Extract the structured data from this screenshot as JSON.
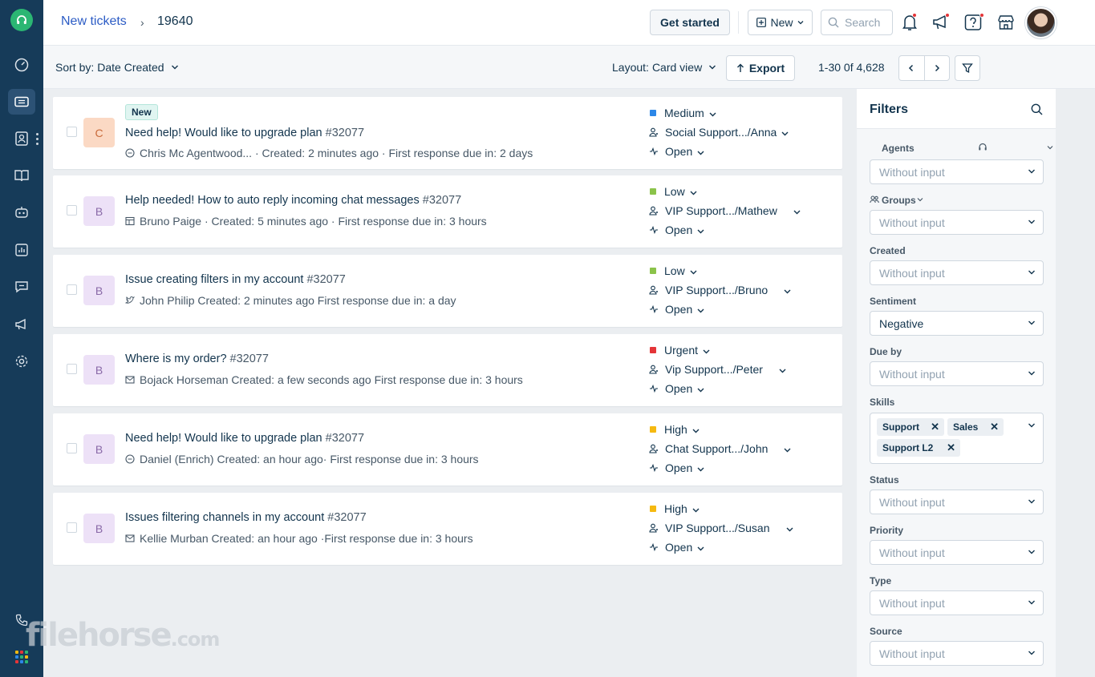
{
  "breadcrumb": {
    "parent": "New tickets",
    "separator": "›",
    "current": "19640"
  },
  "header": {
    "get_started": "Get started",
    "new_label": "New",
    "search_placeholder": "Search"
  },
  "toolbar": {
    "sort_prefix": "Sort by:",
    "sort_value": "Date Created",
    "layout_prefix": "Layout:",
    "layout_value": "Card view",
    "export_label": "Export",
    "pagination": "1-30 0f 4,628"
  },
  "colors": {
    "rail": "#163b59",
    "brand_green": "#2bb673",
    "link": "#2c5cc5",
    "priority_medium": "#2c87e8",
    "priority_low": "#8bc34a",
    "priority_urgent": "#e43538",
    "priority_high": "#f5b911"
  },
  "tickets": [
    {
      "avatar_letter": "C",
      "is_new": true,
      "new_label": "New",
      "subject": "Need help! Would like to upgrade plan",
      "number": "#32077",
      "channel_icon": "chat-bubble-icon",
      "meta": "Chris Mc Agentwood... · Created: 2 minutes ago · First response due in: 2 days",
      "priority": "Medium",
      "group_agent": "Social Support.../Anna",
      "status": "Open"
    },
    {
      "avatar_letter": "B",
      "is_new": false,
      "subject": "Help needed! How to auto reply incoming chat messages",
      "number": "#32077",
      "channel_icon": "portal-icon",
      "meta": "Bruno Paige · Created: 5 minutes ago · First response due in: 3 hours",
      "priority": "Low",
      "group_agent": "VIP Support.../Mathew",
      "status": "Open"
    },
    {
      "avatar_letter": "B",
      "is_new": false,
      "subject": "Issue creating filters in my account",
      "number": "#32077",
      "channel_icon": "twitter-icon",
      "meta": "John Philip   Created: 2 minutes ago   First response due in: a day",
      "priority": "Low",
      "group_agent": "VIP Support.../Bruno",
      "status": "Open"
    },
    {
      "avatar_letter": "B",
      "is_new": false,
      "subject": "Where is my order?",
      "number": "#32077",
      "channel_icon": "email-icon",
      "meta": "Bojack Horseman   Created: a few seconds ago   First response due in: 3 hours",
      "priority": "Urgent",
      "group_agent": "Vip Support.../Peter",
      "status": "Open"
    },
    {
      "avatar_letter": "B",
      "is_new": false,
      "subject": "Need help! Would like to upgrade plan",
      "number": "#32077",
      "channel_icon": "chat-bubble-icon",
      "meta": "Daniel (Enrich)   Created: an hour ago·  First response due in: 3 hours",
      "priority": "High",
      "group_agent": "Chat Support.../John",
      "status": "Open"
    },
    {
      "avatar_letter": "B",
      "is_new": false,
      "subject": "Issues filtering channels in my account",
      "number": "#32077",
      "channel_icon": "email-icon",
      "meta": "Kellie Murban   Created: an hour ago  ·First response due in: 3 hours",
      "priority": "High",
      "group_agent": "VIP Support.../Susan",
      "status": "Open"
    }
  ],
  "filters": {
    "title": "Filters",
    "agents_label": "Agents",
    "agents_value": "Without input",
    "groups_label": "Groups",
    "groups_value": "Without input",
    "created_label": "Created",
    "created_value": "Without input",
    "sentiment_label": "Sentiment",
    "sentiment_value": "Negative",
    "due_label": "Due by",
    "due_value": "Without input",
    "skills_label": "Skills",
    "skills": [
      "Support",
      "Sales",
      "Support L2"
    ],
    "status_label": "Status",
    "status_value": "Without input",
    "priority_label": "Priority",
    "priority_value": "Without input",
    "type_label": "Type",
    "type_value": "Without input",
    "source_label": "Source",
    "source_value": "Without input"
  },
  "watermark": {
    "main": "filehorse",
    "suffix": ".com"
  }
}
